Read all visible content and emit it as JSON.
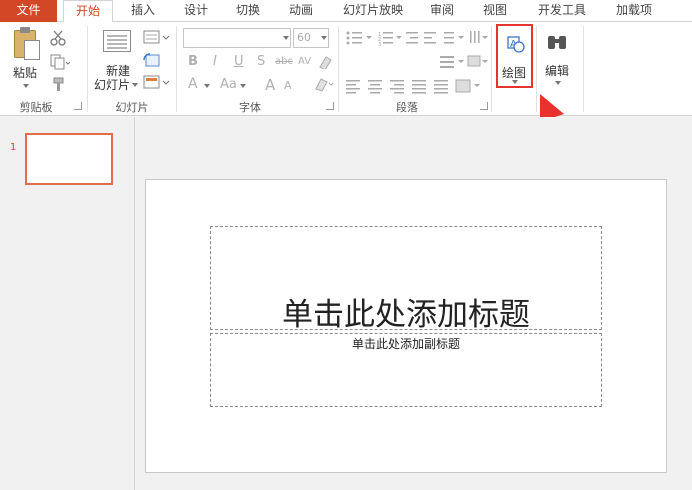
{
  "tabs": [
    "文件",
    "开始",
    "插入",
    "设计",
    "切换",
    "动画",
    "幻灯片放映",
    "审阅",
    "视图",
    "开发工具",
    "加载项"
  ],
  "clipboard": {
    "paste_label": "粘贴",
    "group_label": "剪贴板"
  },
  "slides_group": {
    "new_slide_line1": "新建",
    "new_slide_line2": "幻灯片",
    "group_label": "幻灯片"
  },
  "font_group": {
    "font_size": "60",
    "group_label": "字体",
    "bold": "B",
    "italic": "I",
    "underline": "U",
    "shadow": "S",
    "strike": "abc",
    "spacing": "AV",
    "grow": "A",
    "shrink": "A",
    "font_color": "A",
    "change_case": "Aa"
  },
  "paragraph_group": {
    "group_label": "段落"
  },
  "drawing_group": {
    "label": "绘图"
  },
  "editing_group": {
    "label": "编辑"
  },
  "thumbnails": [
    {
      "number": "1"
    }
  ],
  "slide": {
    "title_placeholder": "单击此处添加标题",
    "subtitle_placeholder": "单击此处添加副标题"
  },
  "colors": {
    "accent": "#d24726",
    "highlight": "#e8322e"
  }
}
